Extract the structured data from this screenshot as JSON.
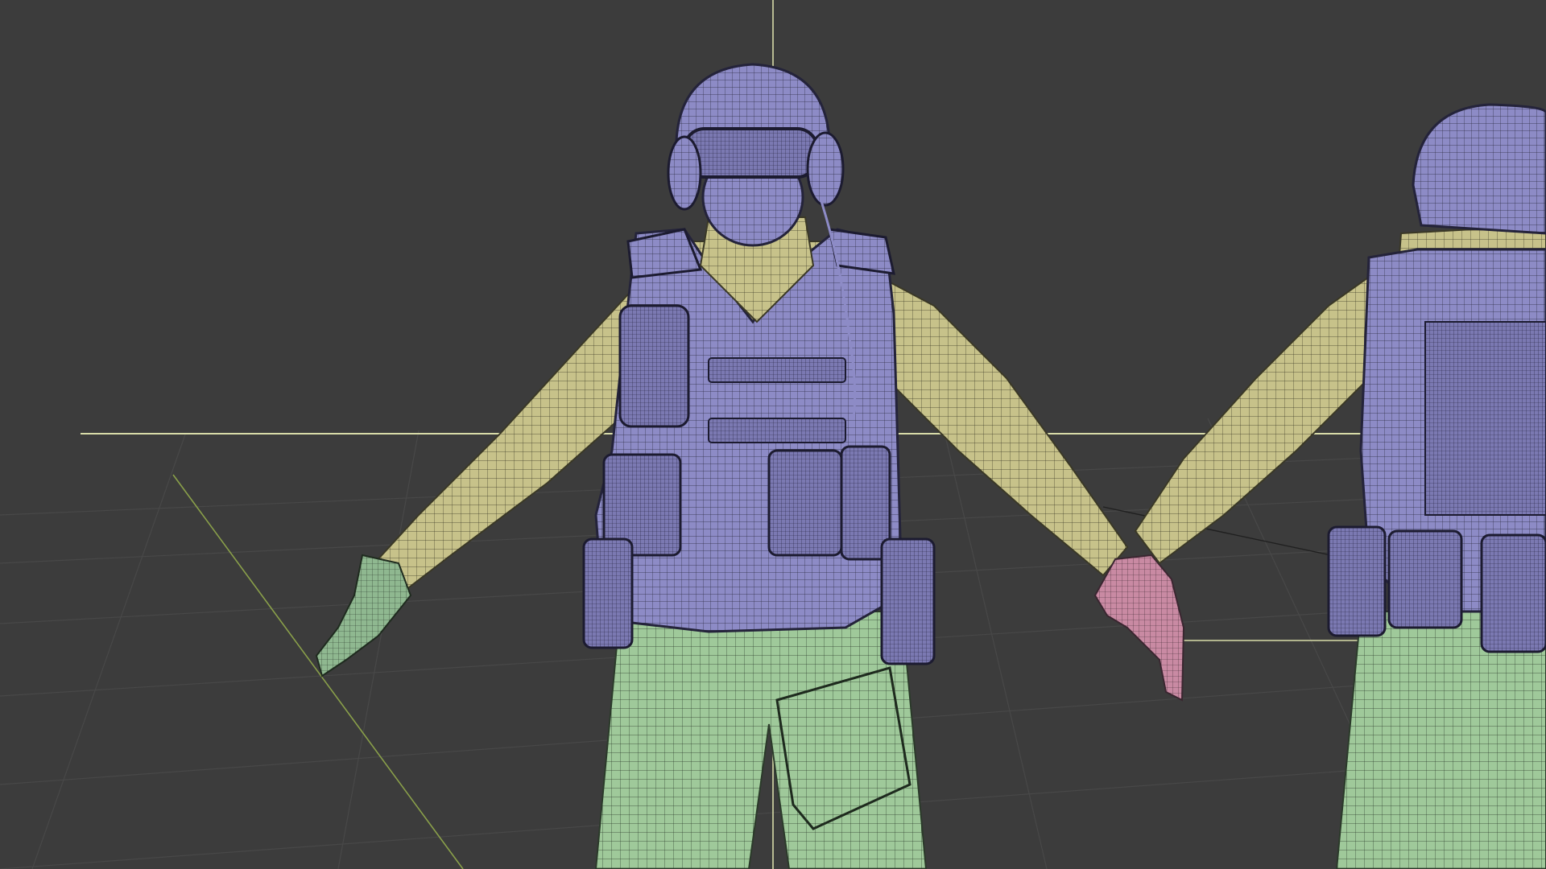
{
  "viewport": {
    "background_color": "#3c3c3c",
    "grid_color": "#474747",
    "x_axis_color": "#d8dba8",
    "y_axis_color": "#8aa04a"
  },
  "materials": {
    "helmet_vest": "#8d8bc6",
    "shirt": "#c7c28a",
    "pants": "#9fc99a",
    "glove_left": "#8fb890",
    "glove_right": "#c98aa3",
    "wire": "#262636"
  },
  "models": [
    {
      "name": "soldier-front"
    },
    {
      "name": "soldier-back"
    }
  ]
}
